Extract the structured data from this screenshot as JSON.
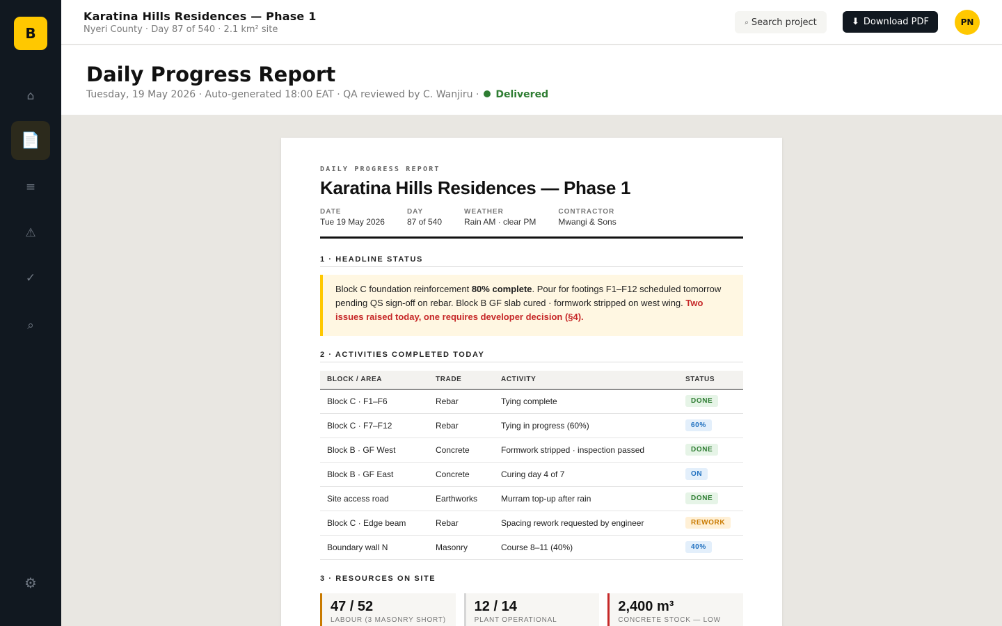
{
  "sidebar": {
    "logo": "B",
    "items": [
      {
        "icon": "home-icon",
        "glyph": "⌂"
      },
      {
        "icon": "document-icon",
        "glyph": "📄"
      },
      {
        "icon": "list-icon",
        "glyph": "≡"
      },
      {
        "icon": "warning-icon",
        "glyph": "⚠"
      },
      {
        "icon": "check-icon",
        "glyph": "✓"
      },
      {
        "icon": "search-icon",
        "glyph": "⌕"
      }
    ],
    "settings_glyph": "⚙"
  },
  "header": {
    "title": "Karatina Hills Residences — Phase 1",
    "subtitle": "Nyeri County · Day 87 of 540 · 2.1 km² site",
    "search_label": "Search project",
    "search_glyph": "⌕",
    "download_label": "Download PDF",
    "download_glyph": "⬇",
    "avatar": "PN"
  },
  "page": {
    "title": "Daily Progress Report",
    "meta": "Tuesday, 19 May 2026 · Auto-generated 18:00 EAT · QA reviewed by C. Wanjiru ·",
    "status": "Delivered"
  },
  "report": {
    "kicker": "DAILY PROGRESS REPORT",
    "title": "Karatina Hills Residences — Phase 1",
    "meta": [
      {
        "label": "DATE",
        "value": "Tue 19 May 2026"
      },
      {
        "label": "DAY",
        "value": "87 of 540"
      },
      {
        "label": "WEATHER",
        "value": "Rain AM · clear PM"
      },
      {
        "label": "CONTRACTOR",
        "value": "Mwangi & Sons"
      }
    ],
    "sections": {
      "s1": "1 · HEADLINE STATUS",
      "s2": "2 · ACTIVITIES COMPLETED TODAY",
      "s3": "3 · RESOURCES ON SITE"
    },
    "headline": {
      "part1": "Block C foundation reinforcement ",
      "bold": "80% complete",
      "part2": ". Pour for footings F1–F12 scheduled tomorrow pending QS sign-off on rebar. Block B GF slab cured · formwork stripped on west wing. ",
      "alert": "Two issues raised today, one requires developer decision (§4)."
    },
    "table": {
      "headers": [
        "BLOCK / AREA",
        "TRADE",
        "ACTIVITY",
        "STATUS"
      ],
      "rows": [
        {
          "area": "Block C · F1–F6",
          "trade": "Rebar",
          "activity": "Tying complete",
          "status": "DONE",
          "kind": "done"
        },
        {
          "area": "Block C · F7–F12",
          "trade": "Rebar",
          "activity": "Tying in progress (60%)",
          "status": "60%",
          "kind": "prog"
        },
        {
          "area": "Block B · GF West",
          "trade": "Concrete",
          "activity": "Formwork stripped · inspection passed",
          "status": "DONE",
          "kind": "done"
        },
        {
          "area": "Block B · GF East",
          "trade": "Concrete",
          "activity": "Curing day 4 of 7",
          "status": "ON",
          "kind": "prog"
        },
        {
          "area": "Site access road",
          "trade": "Earthworks",
          "activity": "Murram top-up after rain",
          "status": "DONE",
          "kind": "done"
        },
        {
          "area": "Block C · Edge beam",
          "trade": "Rebar",
          "activity": "Spacing rework requested by engineer",
          "status": "REWORK",
          "kind": "rework"
        },
        {
          "area": "Boundary wall N",
          "trade": "Masonry",
          "activity": "Course 8–11 (40%)",
          "status": "40%",
          "kind": "prog"
        }
      ]
    },
    "resources": [
      {
        "value": "47 / 52",
        "label": "LABOUR (3 MASONRY SHORT)",
        "kind": "warn"
      },
      {
        "value": "12 / 14",
        "label": "PLANT OPERATIONAL",
        "kind": "ok"
      },
      {
        "value": "2,400 m³",
        "label": "CONCRETE STOCK — LOW",
        "kind": "bad"
      }
    ]
  },
  "colors": {
    "accent": "#ffc800",
    "sidebar": "#111820",
    "success": "#2e7d32",
    "alert": "#c62828",
    "info": "#1e6fbf",
    "warning": "#c97a00"
  }
}
